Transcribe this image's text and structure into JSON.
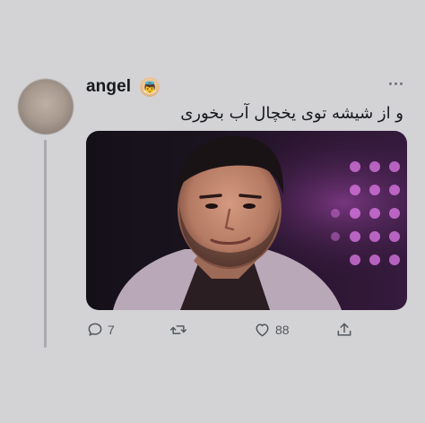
{
  "tweet": {
    "display_name": "angel",
    "name_emoji": "👼",
    "text": "و از شیشه توی یخچال آب بخوری",
    "media_alt": "",
    "actions": {
      "reply_count": "7",
      "retweet_count": "",
      "like_count": "88",
      "share_count": ""
    }
  },
  "icons": {
    "more": "more-dots-icon",
    "reply": "reply-icon",
    "retweet": "retweet-icon",
    "like": "heart-icon",
    "share": "share-icon"
  },
  "colors": {
    "background": "#d3d3d6",
    "text": "#15181c",
    "muted": "#53585d"
  }
}
